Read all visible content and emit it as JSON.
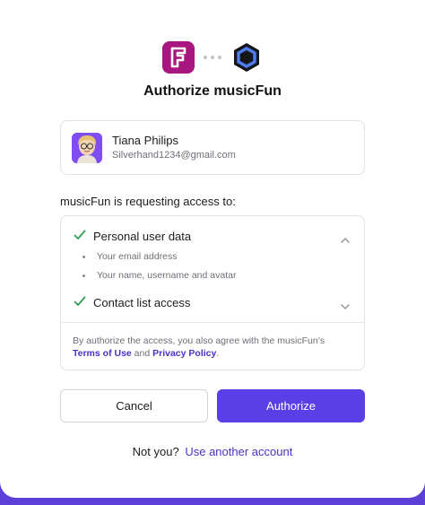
{
  "app": {
    "name": "musicFun",
    "logo_icon": "musicfun-logo-icon",
    "brand_color": "#a8177f"
  },
  "provider": {
    "logo_icon": "provider-logo-icon"
  },
  "title": "Authorize musicFun",
  "account": {
    "name": "Tiana Philips",
    "email": "Silverhand1234@gmail.com"
  },
  "request_label": "musicFun is requesting access to:",
  "permissions": [
    {
      "label": "Personal user data",
      "expanded": true,
      "details": [
        "Your email address",
        "Your name, username and avatar"
      ]
    },
    {
      "label": "Contact list access",
      "expanded": false,
      "details": []
    }
  ],
  "terms": {
    "prefix": "By authorize the access, you also agree with the musicFun’s",
    "terms_link": "Terms of Use",
    "and": "and",
    "privacy_link": "Privacy Policy",
    "suffix": "."
  },
  "buttons": {
    "cancel": "Cancel",
    "authorize": "Authorize"
  },
  "footer": {
    "prompt": "Not you?",
    "link": "Use another account"
  },
  "colors": {
    "accent": "#5b3fe6",
    "check": "#2e9e4f"
  }
}
